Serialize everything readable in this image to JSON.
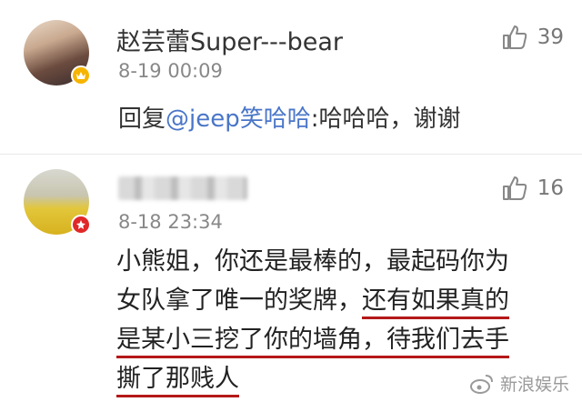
{
  "comments": [
    {
      "username": "赵芸蕾Super---bear",
      "time": "8-19 00:09",
      "likes": "39",
      "reply_prefix": "回复",
      "mention": "@jeep笑哈哈",
      "reply_text": ":哈哈哈，谢谢",
      "badge_icon": "vip-crown-icon",
      "badge_color": "#f6b400"
    },
    {
      "time": "8-18 23:34",
      "likes": "16",
      "content_line1": "小熊姐，你还是最棒的，最起码你为",
      "content_line2a": "女队拿了唯一的奖牌，",
      "content_line2b": "还有如果真的",
      "content_line3": "是某小三挖了你的墙角，待我们去手",
      "content_line4": "撕了那贱人",
      "badge_icon": "member-star-icon",
      "badge_color": "#e02828"
    }
  ],
  "watermark": {
    "text": "新浪娱乐"
  }
}
